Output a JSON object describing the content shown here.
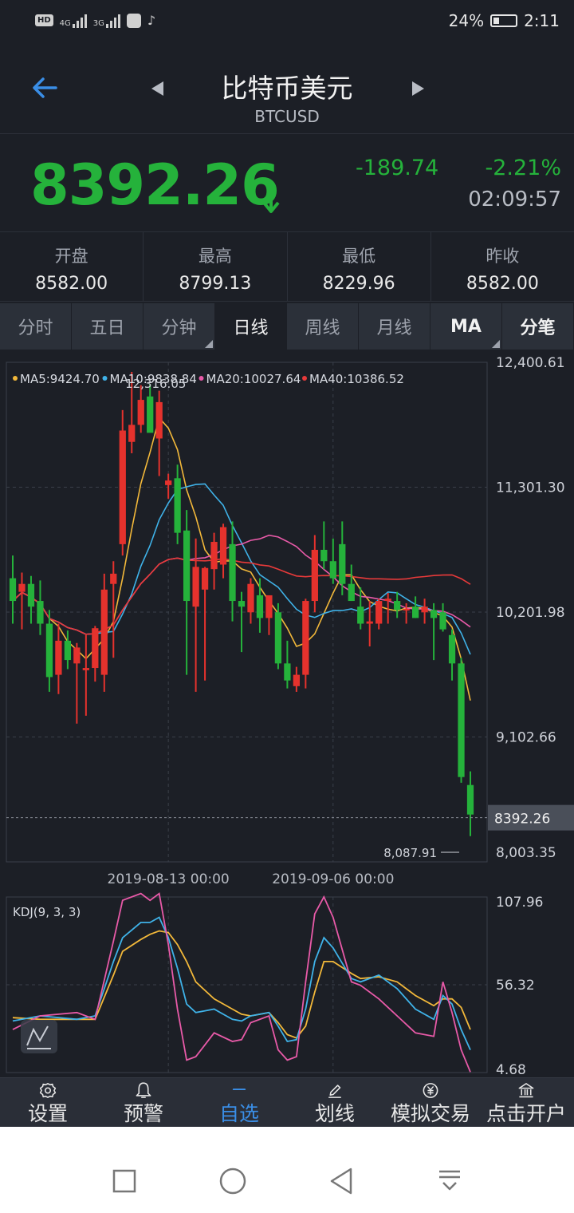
{
  "status_bar": {
    "left_icons": [
      "hd-icon",
      "4g-signal-icon",
      "3g-signal-icon",
      "app-icon",
      "tiktok-icon"
    ],
    "hd_label": "HD",
    "net1_label": "4G",
    "net2_label": "3G",
    "battery_percent": "24%",
    "clock": "2:11"
  },
  "header": {
    "title": "比特币美元",
    "symbol": "BTCUSD"
  },
  "quote": {
    "price": "8392.26",
    "change": "-189.74",
    "change_pct": "-2.21%",
    "time": "02:09:57"
  },
  "stats": [
    {
      "label": "开盘",
      "value": "8582.00"
    },
    {
      "label": "最高",
      "value": "8799.13"
    },
    {
      "label": "最低",
      "value": "8229.96"
    },
    {
      "label": "昨收",
      "value": "8582.00"
    }
  ],
  "tabs": [
    {
      "label": "分时",
      "active": false
    },
    {
      "label": "五日",
      "active": false
    },
    {
      "label": "分钟",
      "active": false
    },
    {
      "label": "日线",
      "active": true
    },
    {
      "label": "周线",
      "active": false
    },
    {
      "label": "月线",
      "active": false
    },
    {
      "label": "MA",
      "active": false
    },
    {
      "label": "分笔",
      "active": false
    }
  ],
  "chart_data": {
    "type": "candlestick",
    "ma_legend": [
      {
        "label": "MA5:9424.70",
        "color": "#f2b83a"
      },
      {
        "label": "MA10:9838.84",
        "color": "#3fb2e8"
      },
      {
        "label": "MA20:10027.64",
        "color": "#e85aa8"
      },
      {
        "label": "MA40:10386.52",
        "color": "#e83a3a"
      }
    ],
    "y_ticks": [
      "12,400.61",
      "11,301.30",
      "10,201.98",
      "9,102.66",
      "8,003.35"
    ],
    "y_tick_values": [
      12400.61,
      11301.3,
      10201.98,
      9102.66,
      8003.35
    ],
    "ylim": [
      8003.35,
      12400.61
    ],
    "current_price_label": "8392.26",
    "current_price": 8392.26,
    "high_marker": "12,316.05",
    "high_value": 12316.05,
    "low_marker": "8,087.91",
    "low_value": 8087.91,
    "x_labels": [
      "2019-08-13 00:00",
      "2019-09-06 00:00"
    ],
    "x_label_index": [
      17,
      35
    ],
    "up_color": "#e5322d",
    "down_color": "#25b23b",
    "candles": [
      [
        10500,
        10700,
        10100,
        10300
      ],
      [
        10380,
        10550,
        10050,
        10450
      ],
      [
        10450,
        10520,
        10100,
        10250
      ],
      [
        10300,
        10480,
        10000,
        10100
      ],
      [
        10100,
        10220,
        9500,
        9630
      ],
      [
        9650,
        10100,
        9480,
        9950
      ],
      [
        9950,
        10040,
        9700,
        9780
      ],
      [
        9750,
        9930,
        9220,
        9890
      ],
      [
        9690,
        10000,
        9290,
        9710
      ],
      [
        9710,
        10080,
        9590,
        10060
      ],
      [
        9650,
        10540,
        9500,
        10400
      ],
      [
        10450,
        10650,
        9800,
        10540
      ],
      [
        10800,
        11980,
        10700,
        11800
      ],
      [
        11700,
        12316,
        11600,
        11850
      ],
      [
        11850,
        12200,
        11780,
        12070
      ],
      [
        12100,
        12210,
        11800,
        11780
      ],
      [
        11730,
        12150,
        11400,
        12050
      ],
      [
        11320,
        11420,
        11200,
        11360
      ],
      [
        11380,
        11500,
        10800,
        10900
      ],
      [
        10920,
        11100,
        9650,
        10300
      ],
      [
        10250,
        10850,
        9500,
        10600
      ],
      [
        10400,
        10600,
        9600,
        10590
      ],
      [
        10580,
        10900,
        10400,
        10820
      ],
      [
        10620,
        10980,
        10500,
        10950
      ],
      [
        10800,
        11000,
        10120,
        10300
      ],
      [
        10300,
        10380,
        9850,
        10250
      ],
      [
        10200,
        10500,
        10100,
        10450
      ],
      [
        10350,
        10500,
        10020,
        10150
      ],
      [
        10150,
        10250,
        10000,
        10350
      ],
      [
        10200,
        10280,
        9700,
        9750
      ],
      [
        9750,
        9950,
        9530,
        9600
      ],
      [
        9550,
        9720,
        9500,
        9650
      ],
      [
        9650,
        10320,
        9530,
        10300
      ],
      [
        10300,
        10880,
        10200,
        10750
      ],
      [
        10750,
        11000,
        10580,
        10650
      ],
      [
        10650,
        10850,
        10450,
        10500
      ],
      [
        10800,
        11000,
        10350,
        10450
      ],
      [
        10450,
        10620,
        10300,
        10300
      ],
      [
        10250,
        10420,
        10050,
        10100
      ],
      [
        10100,
        10300,
        9900,
        10120
      ],
      [
        10100,
        10320,
        10050,
        10300
      ],
      [
        10300,
        10370,
        10100,
        10320
      ],
      [
        10300,
        10380,
        10150,
        10220
      ],
      [
        10220,
        10280,
        10100,
        10230
      ],
      [
        10250,
        10340,
        10150,
        10150
      ],
      [
        10200,
        10320,
        10100,
        10250
      ],
      [
        10220,
        10280,
        9780,
        10150
      ],
      [
        10200,
        10280,
        10030,
        10050
      ],
      [
        10000,
        10050,
        9600,
        9750
      ],
      [
        9750,
        9800,
        8700,
        8750
      ],
      [
        8680,
        8800,
        8230,
        8420
      ]
    ],
    "kdj": {
      "label": "KDJ(9, 3, 3)",
      "y_ticks": [
        "107.96",
        "56.32",
        "4.68"
      ],
      "ylim": [
        4.68,
        107.96
      ],
      "x_index": [
        0,
        3,
        7,
        9,
        11,
        12,
        14,
        15,
        16,
        17,
        18,
        19,
        20,
        22,
        24,
        25,
        26,
        28,
        29,
        30,
        31,
        32,
        33,
        34,
        35,
        37,
        38,
        40,
        42,
        44,
        46,
        47,
        48,
        49,
        50
      ],
      "K": [
        35,
        38,
        36,
        38,
        70,
        84,
        93,
        93,
        96,
        84,
        66,
        45,
        40,
        42,
        36,
        35,
        38,
        40,
        32,
        23,
        24,
        42,
        70,
        84,
        78,
        60,
        58,
        62,
        54,
        42,
        36,
        50,
        45,
        30,
        18
      ],
      "D": [
        37,
        36,
        36,
        36,
        62,
        76,
        83,
        86,
        88,
        87,
        80,
        70,
        58,
        48,
        42,
        39,
        38,
        40,
        34,
        27,
        25,
        32,
        52,
        70,
        70,
        63,
        60,
        61,
        58,
        50,
        44,
        48,
        48,
        43,
        30
      ],
      "J": [
        30,
        38,
        40,
        36,
        82,
        106,
        110,
        106,
        110,
        80,
        42,
        12,
        14,
        28,
        23,
        24,
        34,
        38,
        18,
        12,
        14,
        58,
        98,
        108,
        96,
        58,
        56,
        48,
        38,
        28,
        26,
        58,
        40,
        18,
        5
      ]
    }
  },
  "bottom_nav": [
    {
      "icon": "gear-icon",
      "label": "设置"
    },
    {
      "icon": "bell-icon",
      "label": "预警"
    },
    {
      "icon": "minus-icon",
      "label": "自选"
    },
    {
      "icon": "pen-icon",
      "label": "划线"
    },
    {
      "icon": "yen-coin-icon",
      "label": "模拟交易"
    },
    {
      "icon": "bank-icon",
      "label": "点击开户"
    }
  ],
  "system_nav": [
    "square-icon",
    "circle-icon",
    "triangle-back-icon",
    "download-icon"
  ]
}
